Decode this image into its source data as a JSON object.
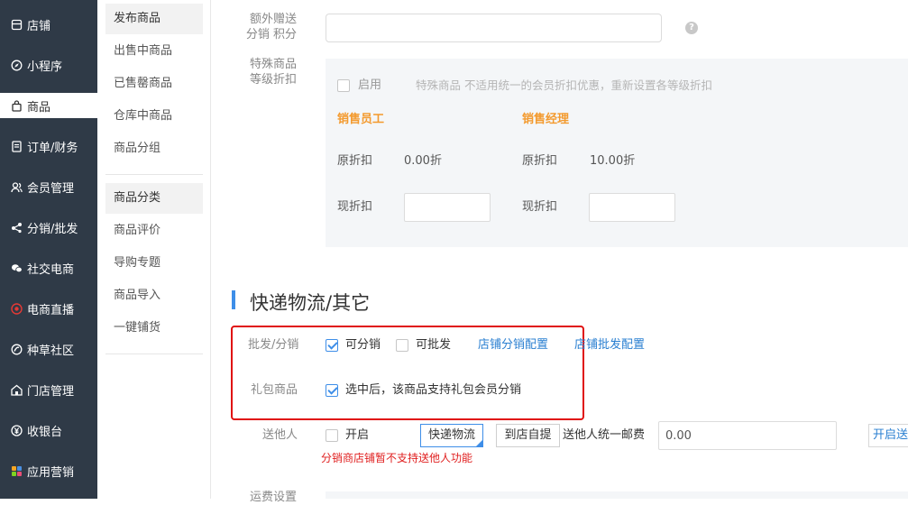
{
  "sidebar": {
    "items": [
      {
        "label": "店铺",
        "icon": "store-icon"
      },
      {
        "label": "小程序",
        "icon": "compass-icon"
      },
      {
        "label": "商品",
        "icon": "bag-icon"
      },
      {
        "label": "订单/财务",
        "icon": "document-icon"
      },
      {
        "label": "会员管理",
        "icon": "members-icon"
      },
      {
        "label": "分销/批发",
        "icon": "share-icon"
      },
      {
        "label": "社交电商",
        "icon": "chat-icon"
      },
      {
        "label": "电商直播",
        "icon": "live-icon"
      },
      {
        "label": "种草社区",
        "icon": "community-icon"
      },
      {
        "label": "门店管理",
        "icon": "shop-icon"
      },
      {
        "label": "收银台",
        "icon": "yen-icon"
      },
      {
        "label": "应用营销",
        "icon": "apps-icon"
      }
    ]
  },
  "submenu": {
    "items": [
      "发布商品",
      "出售中商品",
      "已售罄商品",
      "仓库中商品",
      "商品分组",
      "商品分类",
      "商品评价",
      "导购专题",
      "商品导入",
      "一键铺货"
    ]
  },
  "form": {
    "extra_points_label_1": "额外赠送",
    "extra_points_label_2": "分销 积分",
    "special_label_1": "特殊商品",
    "special_label_2": "等级折扣",
    "enable_label": "启用",
    "special_hint": "特殊商品 不适用统一的会员折扣优惠，重新设置各等级折扣",
    "levels": [
      {
        "name": "销售员工",
        "orig_label": "原折扣",
        "orig_value": "0.00折",
        "now_label": "现折扣"
      },
      {
        "name": "销售经理",
        "orig_label": "原折扣",
        "orig_value": "10.00折",
        "now_label": "现折扣"
      }
    ]
  },
  "section": {
    "title": "快递物流/其它",
    "wholesale_label": "批发/分销",
    "can_distribute": "可分销",
    "can_wholesale": "可批发",
    "store_distribute_config": "店铺分销配置",
    "store_wholesale_config": "店铺批发配置",
    "gift_label": "礼包商品",
    "gift_text": "选中后，该商品支持礼包会员分销",
    "send_label": "送他人",
    "send_enable": "开启",
    "express_btn": "快递物流",
    "pickup_btn": "到店自提",
    "uniform_postage_label": "送他人统一邮费",
    "postage_value": "0.00",
    "open_send_link": "开启送",
    "warning": "分销商店铺暂不支持送他人功能",
    "freight_label": "运费设置"
  }
}
